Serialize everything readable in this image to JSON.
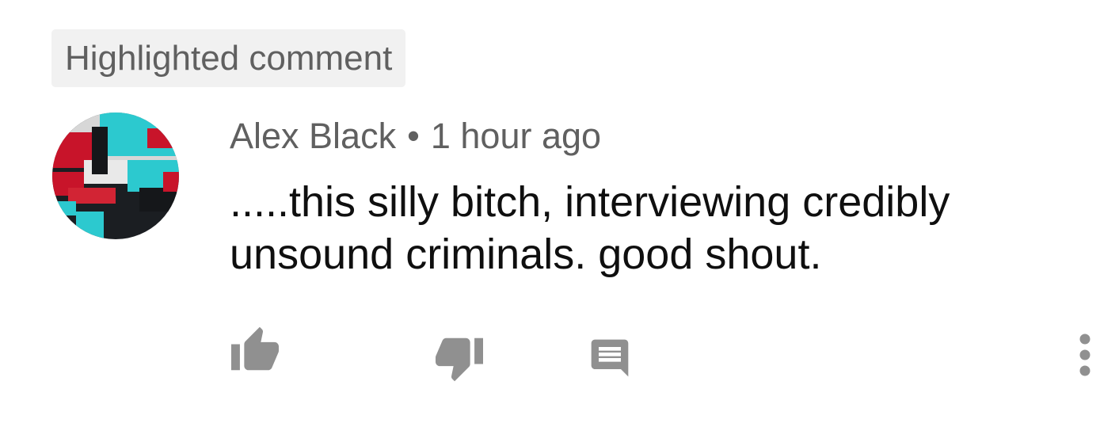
{
  "comment": {
    "badge": "Highlighted comment",
    "author": "Alex Black",
    "separator": "•",
    "timestamp": "1 hour ago",
    "text": ".....this silly bitch, interviewing credibly unsound criminals. good shout.",
    "avatar": "user-avatar"
  },
  "actions": {
    "like_icon": "thumb-up-icon",
    "dislike_icon": "thumb-down-icon",
    "reply_icon": "comment-reply-icon",
    "more_icon": "more-vertical-icon"
  },
  "colors": {
    "badge_background": "#f1f1f1",
    "meta_text": "#606060",
    "body_text": "#0f0f0f",
    "icon": "#909090"
  }
}
